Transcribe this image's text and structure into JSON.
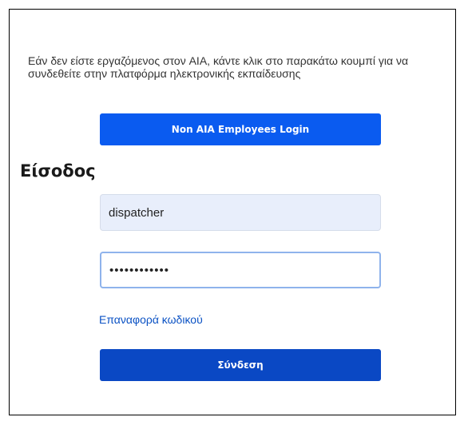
{
  "notice_text": "Εάν δεν είστε εργαζόμενος στον AIA, κάντε κλικ στο παρακάτω κουμπί για να συνδεθείτε στην πλατφόρμα ηλεκτρονικής εκπαίδευσης",
  "non_aia_button_label": "Non AIA Employees Login",
  "login_title": "Είσοδος",
  "username_value": "dispatcher",
  "password_value": "••••••••••••",
  "forgot_password_label": "Επαναφορά κωδικού",
  "login_button_label": "Σύνδεση",
  "colors": {
    "primary_button": "#0a5bf0",
    "login_button": "#0a48c4",
    "link": "#0b52c4",
    "username_bg": "#e8eefb",
    "password_focus_border": "#8fb3ec"
  }
}
